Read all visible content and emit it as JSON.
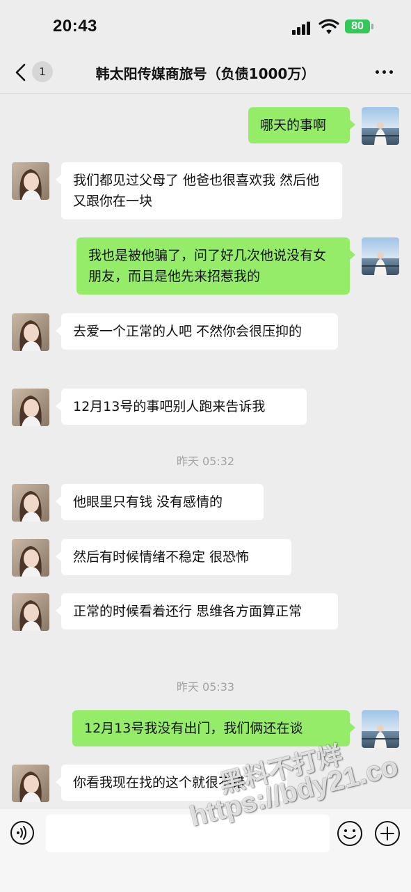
{
  "status_bar": {
    "time": "20:43",
    "battery": "80"
  },
  "header": {
    "back_count": "1",
    "title": "韩太阳传媒商旅号（负债1000万）"
  },
  "messages": [
    {
      "side": "out",
      "text": "哪天的事啊"
    },
    {
      "side": "in",
      "text": "我们都见过父母了 他爸也很喜欢我 然后他又跟你在一块"
    },
    {
      "side": "out",
      "text": "我也是被他骗了，问了好几次他说没有女朋友，而且是他先来招惹我的"
    },
    {
      "side": "in",
      "text": "去爱一个正常的人吧 不然你会很压抑的"
    },
    {
      "side": "in",
      "text": "12月13号的事吧别人跑来告诉我"
    },
    {
      "side": "in",
      "text": "他眼里只有钱 没有感情的"
    },
    {
      "side": "in",
      "text": "然后有时候情绪不稳定 很恐怖"
    },
    {
      "side": "in",
      "text": "正常的时候看着还行 思维各方面算正常"
    },
    {
      "side": "out",
      "text": "12月13号我没有出门，我们俩还在谈"
    },
    {
      "side": "in",
      "text": "你看我现在找的这个就很不错"
    }
  ],
  "timestamps": [
    "昨天 05:32",
    "昨天 05:33"
  ],
  "watermark": {
    "line1": "黑料不打烊",
    "line2": "https://bdy21.co"
  },
  "icons": {
    "back": "chevron-left-icon",
    "more": "more-dots-icon",
    "voice": "voice-icon",
    "emoji": "emoji-icon",
    "plus": "plus-icon"
  },
  "colors": {
    "background": "#ededed",
    "outgoing_bubble": "#95ec69",
    "incoming_bubble": "#ffffff",
    "battery": "#34c759"
  }
}
